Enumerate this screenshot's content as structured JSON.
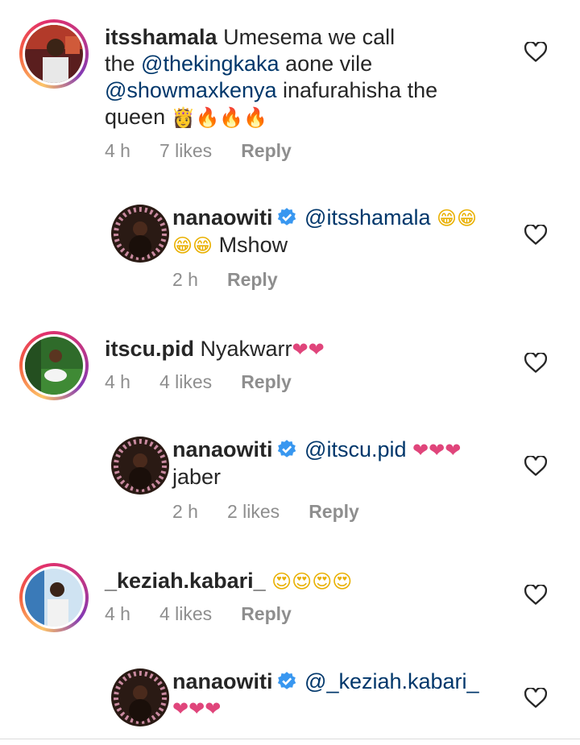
{
  "comments": [
    {
      "username": "itsshamala",
      "text_line1": "Umesema we call",
      "text_line2_pre": "the ",
      "mention1": "@thekingkaka",
      "text_line2_post": " aone vile",
      "mention2": "@showmaxkenya",
      "text_line3_post": " inafurahisha the",
      "text_line4": "queen",
      "emojis": "👸🔥🔥🔥",
      "time": "4 h",
      "likes": "7 likes",
      "reply": "Reply"
    },
    {
      "username": "nanaowiti",
      "mention": "@itsshamala",
      "emojis_line1": "😁😁",
      "emojis_line2": "😁😁",
      "text": "Mshow",
      "time": "2 h",
      "reply": "Reply"
    },
    {
      "username": "itscu.pid",
      "text": "Nyakwarr",
      "emojis": "❤❤",
      "time": "4 h",
      "likes": "4 likes",
      "reply": "Reply"
    },
    {
      "username": "nanaowiti",
      "mention": "@itscu.pid",
      "emojis": "❤❤❤",
      "text": "jaber",
      "time": "2 h",
      "likes": "2 likes",
      "reply": "Reply"
    },
    {
      "username": "_keziah.kabari_",
      "emojis": "😍😍😍😍",
      "time": "4 h",
      "likes": "4 likes",
      "reply": "Reply"
    },
    {
      "username": "nanaowiti",
      "mention": "@_keziah.kabari_",
      "emojis": "❤❤❤"
    }
  ],
  "colors": {
    "mention": "#00376b",
    "meta": "#8e8e8e",
    "verified": "#3897f0"
  },
  "icons": {
    "like": "heart-outline-icon",
    "verified": "verified-badge-icon"
  }
}
